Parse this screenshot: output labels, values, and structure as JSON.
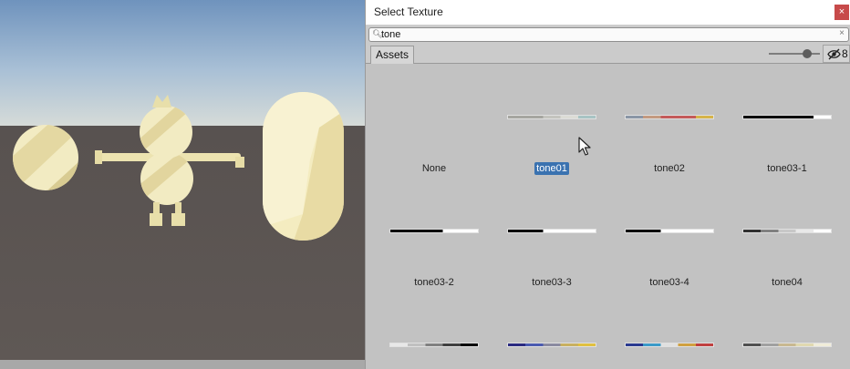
{
  "window": {
    "title": "Select Texture",
    "close_glyph": "×"
  },
  "search": {
    "value": "tone",
    "icon": "search-icon",
    "clear_glyph": "×"
  },
  "toolbar": {
    "tab_label": "Assets",
    "hidden_count": "8",
    "zoom_level": 0.8
  },
  "colors": {
    "selection": "#3a72b0",
    "close_button": "#c74a4a",
    "panel_bg": "#c2c2c2",
    "sky_top": "#7fa0c4",
    "ground": "#5d5553",
    "mesh": "#f1e8b8"
  },
  "items": [
    {
      "label": "None",
      "selected": false,
      "ramp": []
    },
    {
      "label": "tone01",
      "selected": true,
      "ramp": [
        "#a6a6a0",
        "#a6a6a0",
        "#c4c4be",
        "#dcdcd6",
        "#a8c4c4"
      ]
    },
    {
      "label": "tone02",
      "selected": false,
      "ramp": [
        "#8a96a6",
        "#c49a80",
        "#c45a5a",
        "#c45a5a",
        "#d6b44a"
      ]
    },
    {
      "label": "tone03-1",
      "selected": false,
      "ramp": [
        "#000000",
        "#000000",
        "#000000",
        "#000000",
        "#ffffff"
      ]
    },
    {
      "label": "tone03-2",
      "selected": false,
      "ramp": [
        "#000000",
        "#000000",
        "#000000",
        "#ffffff",
        "#ffffff"
      ]
    },
    {
      "label": "tone03-3",
      "selected": false,
      "ramp": [
        "#000000",
        "#000000",
        "#ffffff",
        "#ffffff",
        "#ffffff"
      ]
    },
    {
      "label": "tone03-4",
      "selected": false,
      "ramp": [
        "#000000",
        "#000000",
        "#ffffff",
        "#ffffff",
        "#ffffff"
      ]
    },
    {
      "label": "tone04",
      "selected": false,
      "ramp": [
        "#303030",
        "#808080",
        "#c8c8c8",
        "#e8e8e8",
        "#ffffff"
      ]
    },
    {
      "label": "",
      "selected": false,
      "ramp": [
        "#e8e8e8",
        "#c0c0c0",
        "#808080",
        "#404040",
        "#000000"
      ]
    },
    {
      "label": "",
      "selected": false,
      "ramp": [
        "#2a2a80",
        "#4a5ab0",
        "#8a8aa0",
        "#c8b060",
        "#e0c040"
      ]
    },
    {
      "label": "",
      "selected": false,
      "ramp": [
        "#2a3a90",
        "#3a9ac8",
        "#e0e0e0",
        "#d0a040",
        "#c04040"
      ]
    },
    {
      "label": "",
      "selected": false,
      "ramp": [
        "#505050",
        "#a0a0a0",
        "#c8b890",
        "#e0d8b0",
        "#f0ecd8"
      ]
    }
  ]
}
